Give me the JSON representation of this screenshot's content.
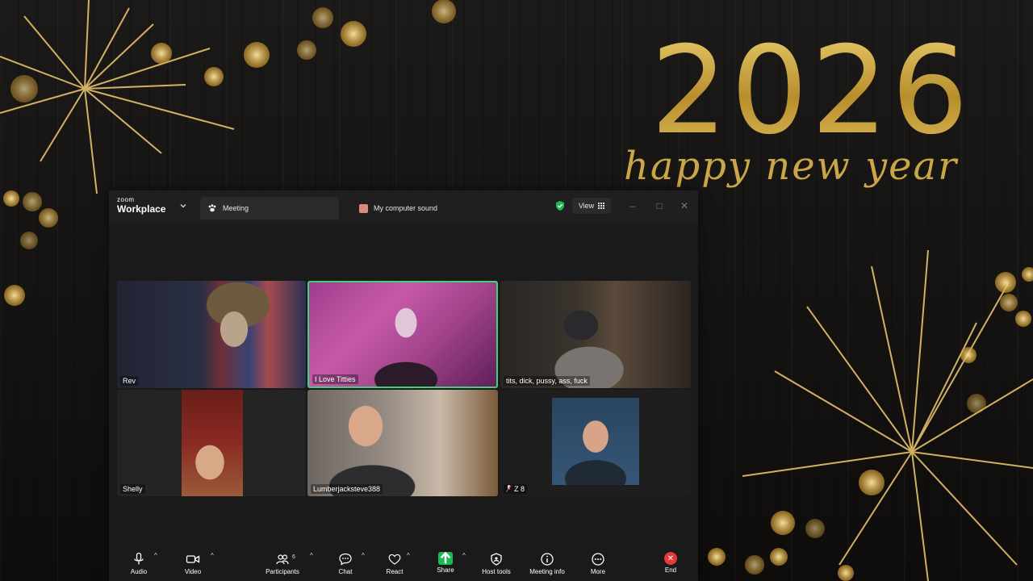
{
  "background": {
    "year": "2026",
    "greeting": "happy new year"
  },
  "titlebar": {
    "brand_small": "zoom",
    "brand_big": "Workplace",
    "tabs": [
      {
        "label": "Meeting",
        "icon": "paw-icon"
      },
      {
        "label": "My computer sound",
        "icon": "sound-icon"
      }
    ],
    "view_label": "View"
  },
  "gallery": {
    "participants": [
      {
        "name": "Rev",
        "active_speaker": false
      },
      {
        "name": "I Love Titties",
        "active_speaker": true
      },
      {
        "name": "tits, dick, pussy, ass, fuck",
        "active_speaker": false
      },
      {
        "name": "Shelly",
        "active_speaker": false
      },
      {
        "name": "Lumberjacksteve388",
        "active_speaker": false
      },
      {
        "name": "Z 8",
        "active_speaker": false,
        "muted": true
      }
    ]
  },
  "toolbar": {
    "audio": "Audio",
    "video": "Video",
    "participants": "Participants",
    "participants_count": "6",
    "chat": "Chat",
    "react": "React",
    "share": "Share",
    "host_tools": "Host tools",
    "meeting_info": "Meeting info",
    "more": "More",
    "end": "End"
  },
  "colors": {
    "gold": "#c9a646",
    "active_speaker_border": "#3cd37a",
    "share_green": "#1db954",
    "end_red": "#e53935"
  }
}
